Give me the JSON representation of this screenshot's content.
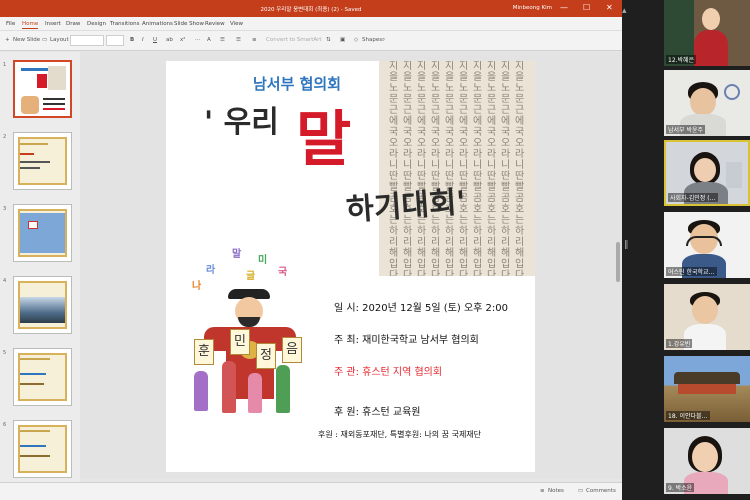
{
  "window": {
    "title": "2020 우리말 웅변대회 (최종) (2) - Saved",
    "user": "Minbeong Kim",
    "minimize": "—",
    "maximize": "☐",
    "close": "✕"
  },
  "menu": {
    "tabs": [
      "File",
      "Home",
      "Insert",
      "Draw",
      "Design",
      "Transitions",
      "Animations",
      "Slide Show",
      "Review",
      "View"
    ],
    "active": "Home"
  },
  "toolbar": {
    "new_slide": "New Slide",
    "layout": "Layout",
    "bold": "B",
    "italic": "I",
    "underline": "U",
    "convert_smartart": "Convert to SmartArt",
    "shapes": "Shapes"
  },
  "thumbnails": [
    "1",
    "2",
    "3",
    "4",
    "5",
    "6"
  ],
  "slide": {
    "org": "남서부 협의회",
    "title_part1": "' 우리",
    "title_mal": "말",
    "title_part2": "하기대회'",
    "stele_text": "지을노문근에국오라니딴빨곰호는하리해입다리",
    "fly_letters": [
      "나",
      "라",
      "말",
      "미",
      "국",
      "글"
    ],
    "jamo": [
      "훈",
      "민",
      "정",
      "음"
    ],
    "date_line": "일 시: 2020년 12월 5일 (토) 오후 2:00",
    "host_line": "주 최: 재미한국학교 남서부 협의회",
    "organizer_line": "주 관: 휴스턴 지역 협의회",
    "support_line": "후 원:  휴스턴 교육원",
    "sponsor_line": "후원 : 재외동포재단,      특별후원: 나의 꿈 국제재단"
  },
  "statusbar": {
    "notes": "Notes",
    "comments": "Comments"
  },
  "participants": [
    {
      "name": "12.박혜은"
    },
    {
      "name": "남서부 박윤주"
    },
    {
      "name": "사회자-김민정 (…"
    },
    {
      "name": "어스틴 한국학교…"
    },
    {
      "name": "1.강유빈"
    },
    {
      "name": "18. 이안다블…"
    },
    {
      "name": "9. 박소윤"
    }
  ],
  "colors": {
    "accent": "#c43e1c",
    "active_speaker": "#d9c334",
    "title_blue": "#2f76bf",
    "title_red": "#d51b2a"
  }
}
